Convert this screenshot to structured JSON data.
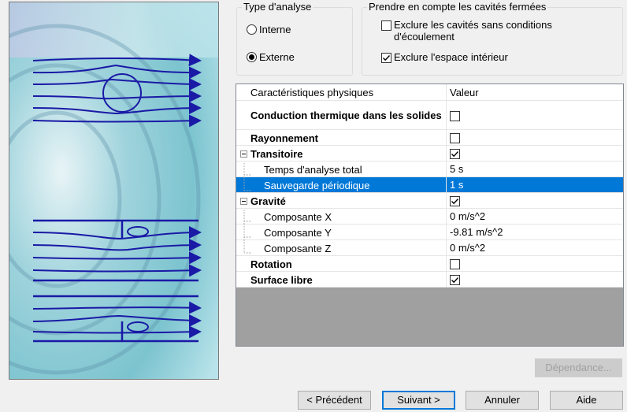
{
  "analysis_type": {
    "title": "Type d'analyse",
    "options": [
      {
        "label": "Interne",
        "selected": false
      },
      {
        "label": "Externe",
        "selected": true
      }
    ]
  },
  "closed_cavities": {
    "title": "Prendre en compte les cavités fermées",
    "options": [
      {
        "label": "Exclure les cavités sans conditions d'écoulement",
        "checked": false
      },
      {
        "label": "Exclure l'espace intérieur",
        "checked": true
      }
    ]
  },
  "grid": {
    "col_name": "Caractéristiques physiques",
    "col_value": "Valeur",
    "rows": [
      {
        "label": "Conduction thermique dans les solides",
        "bold": true,
        "type": "checkbox",
        "checked": false
      },
      {
        "label": "Rayonnement",
        "bold": true,
        "type": "checkbox",
        "checked": false
      },
      {
        "label": "Transitoire",
        "bold": true,
        "type": "checkbox",
        "checked": true,
        "expanded": true
      },
      {
        "label": "Temps d'analyse total",
        "bold": false,
        "child": true,
        "type": "text",
        "value": "5 s"
      },
      {
        "label": "Sauvegarde périodique",
        "bold": false,
        "child": true,
        "type": "text",
        "value": "1 s",
        "selected": true
      },
      {
        "label": "Gravité",
        "bold": true,
        "type": "checkbox",
        "checked": true,
        "expanded": true
      },
      {
        "label": "Composante X",
        "bold": false,
        "child": true,
        "type": "text",
        "value": "0 m/s^2"
      },
      {
        "label": "Composante Y",
        "bold": false,
        "child": true,
        "type": "text",
        "value": "-9.81 m/s^2"
      },
      {
        "label": "Composante Z",
        "bold": false,
        "child": true,
        "type": "text",
        "value": "0 m/s^2"
      },
      {
        "label": "Rotation",
        "bold": true,
        "type": "checkbox",
        "checked": false
      },
      {
        "label": "Surface libre",
        "bold": true,
        "type": "checkbox",
        "checked": true
      }
    ]
  },
  "buttons": {
    "dependance": "Dépendance...",
    "previous": "< Précédent",
    "next": "Suivant >",
    "cancel": "Annuler",
    "help": "Aide"
  }
}
